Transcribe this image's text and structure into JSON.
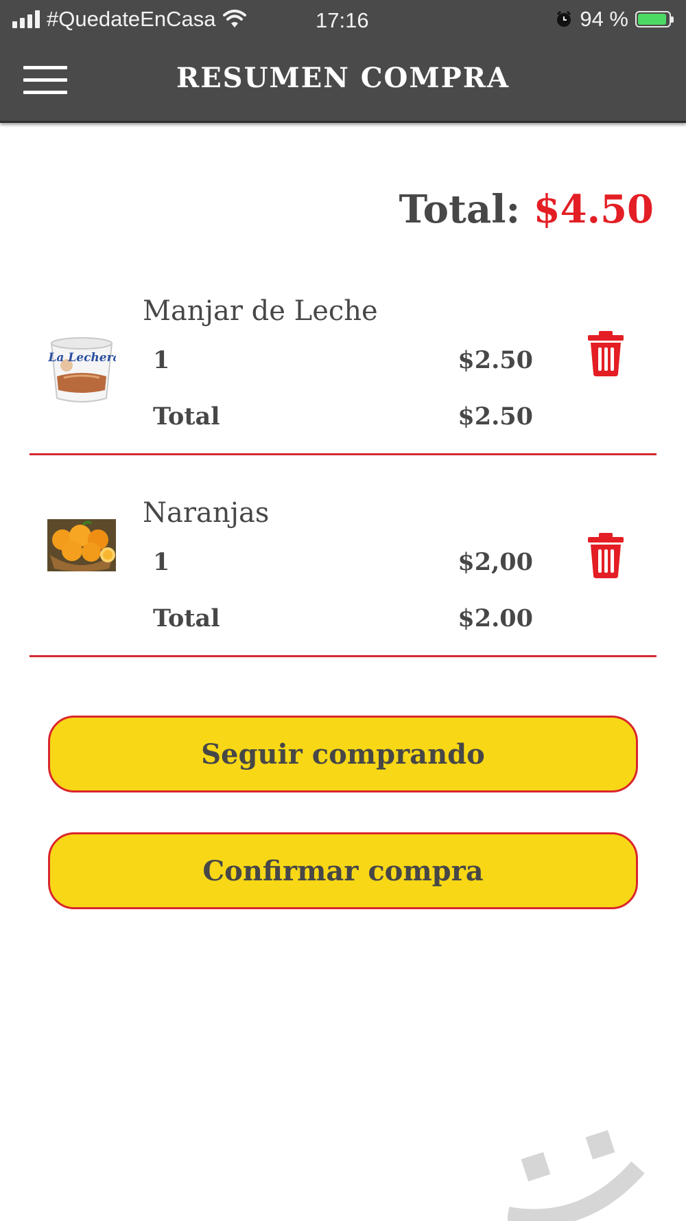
{
  "status_bar": {
    "carrier": "#QuedateEnCasa",
    "time": "17:16",
    "battery": "94 %",
    "battery_level": 0.94,
    "icons": [
      "signal-icon",
      "wifi-icon",
      "alarm-icon",
      "battery-icon"
    ]
  },
  "header": {
    "title": "RESUMEN COMPRA",
    "menu_icon": "hamburger-icon",
    "background": "#4b4a4a"
  },
  "summary": {
    "total_label": "Total: ",
    "total_value": "$4.50"
  },
  "items": [
    {
      "name": "Manjar de Leche",
      "quantity": "1",
      "unit_price": "$2.50",
      "total_label": "Total",
      "line_total": "$2.50",
      "image": "la-lechera-jar-thumbnail",
      "image_text": "La Lechera"
    },
    {
      "name": "Naranjas",
      "quantity": "1",
      "unit_price": "$2,00",
      "total_label": "Total",
      "line_total": "$2.00",
      "image": "oranges-thumbnail"
    }
  ],
  "actions": {
    "continue_label": "Seguir comprando",
    "confirm_label": "Confirmar compra"
  },
  "colors": {
    "accent_red": "#e31e24",
    "button_yellow": "#f8d816",
    "text": "#474747",
    "smiley_grey": "#d6d6d6"
  }
}
